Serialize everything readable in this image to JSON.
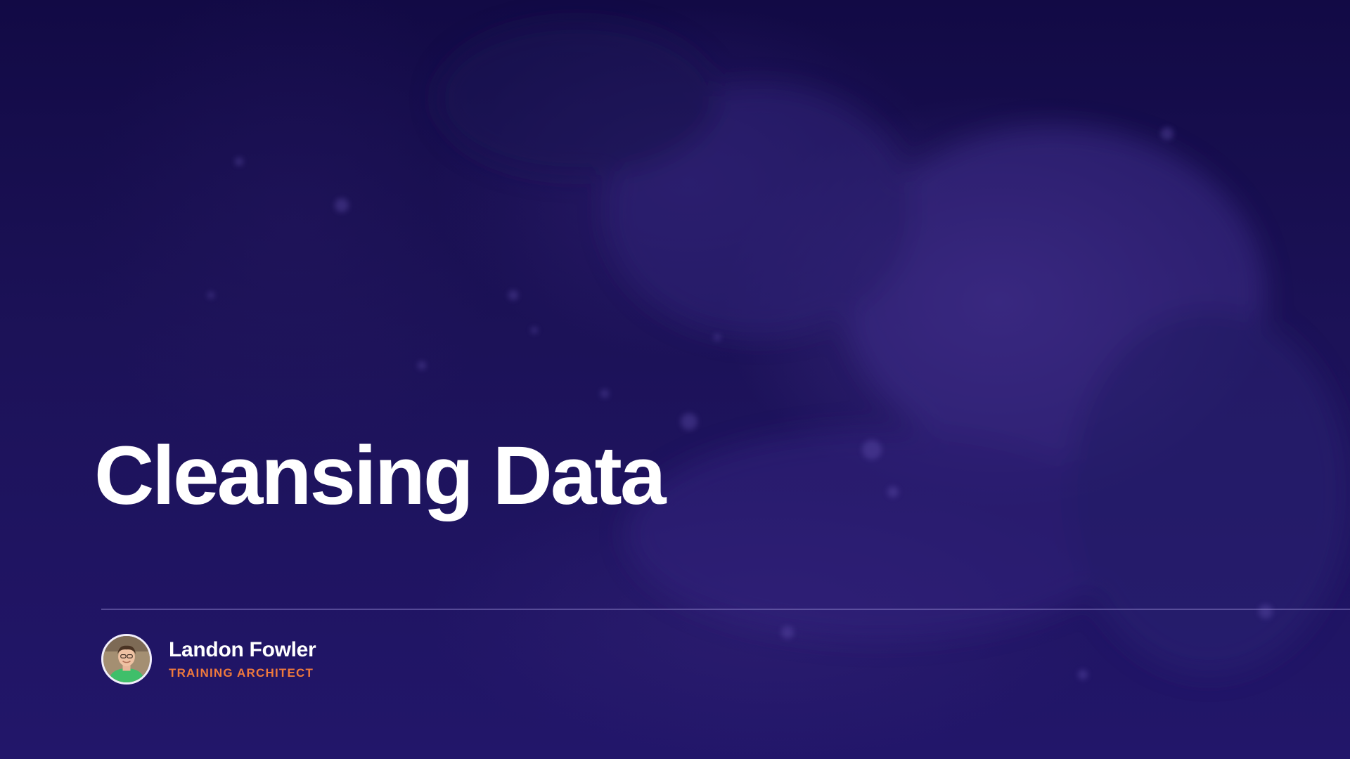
{
  "slide": {
    "title": "Cleansing Data",
    "background_image": "abstract-water-splash-photo",
    "colors": {
      "background": "#1c1258",
      "title": "#ffffff",
      "accent": "#f07a3c",
      "divider": "#8c82d2"
    }
  },
  "presenter": {
    "name": "Landon Fowler",
    "role": "TRAINING ARCHITECT",
    "avatar": "presenter-avatar-photo"
  }
}
